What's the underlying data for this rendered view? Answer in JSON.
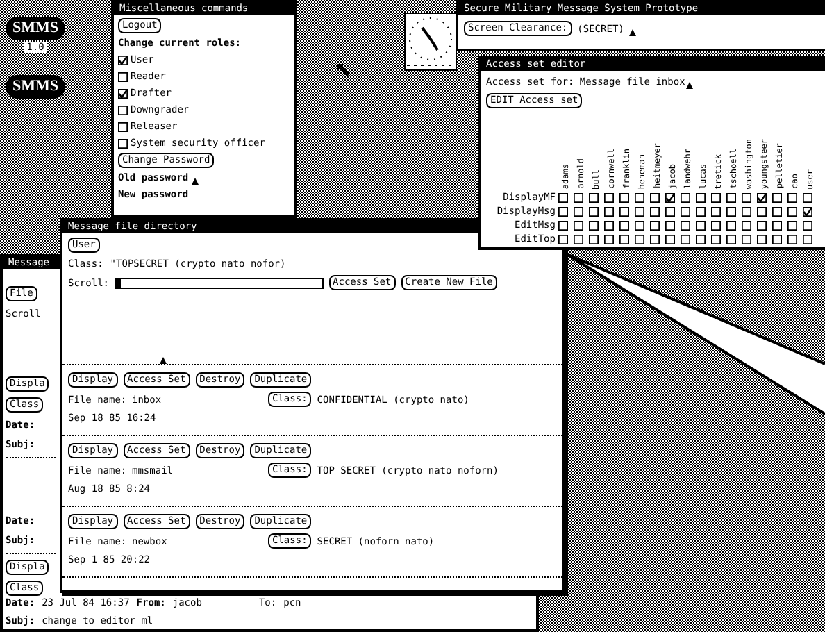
{
  "desktop_icons": [
    {
      "label": "SMMS",
      "caption": "1.0"
    },
    {
      "label": "SMMS"
    }
  ],
  "misc_window": {
    "title": "Miscellaneous commands",
    "logout": "Logout",
    "roles_heading": "Change current roles:",
    "roles": [
      {
        "label": "User",
        "checked": true
      },
      {
        "label": "Reader",
        "checked": false
      },
      {
        "label": "Drafter",
        "checked": true
      },
      {
        "label": "Downgrader",
        "checked": false
      },
      {
        "label": "Releaser",
        "checked": false
      },
      {
        "label": "System security officer",
        "checked": false
      }
    ],
    "change_password": "Change Password",
    "old_password": "Old password",
    "new_password": "New password"
  },
  "prototype_window": {
    "title": "Secure Military Message System Prototype",
    "clearance_button": "Screen Clearance:",
    "clearance": "(SECRET)"
  },
  "access_editor": {
    "title": "Access set editor",
    "access_for": "Access set for: Message file inbox",
    "edit_button": "EDIT Access set",
    "users": [
      "adams",
      "arnold",
      "bull",
      "cornwell",
      "franklin",
      "heneman",
      "heitmeyer",
      "jacob",
      "landwehr",
      "lucas",
      "tretick",
      "tschoell",
      "washington",
      "youngsteer",
      "pelletier",
      "cao",
      "user"
    ],
    "rows": [
      {
        "label": "DisplayMF",
        "checked": [
          false,
          false,
          false,
          false,
          false,
          false,
          false,
          true,
          false,
          false,
          false,
          false,
          false,
          true,
          false,
          false,
          false
        ]
      },
      {
        "label": "DisplayMsg",
        "checked": [
          false,
          false,
          false,
          false,
          false,
          false,
          false,
          false,
          false,
          false,
          false,
          false,
          false,
          false,
          false,
          false,
          true
        ]
      },
      {
        "label": "EditMsg",
        "checked": [
          false,
          false,
          false,
          false,
          false,
          false,
          false,
          false,
          false,
          false,
          false,
          false,
          false,
          false,
          false,
          false,
          false
        ]
      },
      {
        "label": "EditTop",
        "checked": [
          false,
          false,
          false,
          false,
          false,
          false,
          false,
          false,
          false,
          false,
          false,
          false,
          false,
          false,
          false,
          false,
          false
        ]
      }
    ]
  },
  "message_window": {
    "title": "Message",
    "side_items": [
      {
        "kind": "button",
        "text": "File"
      },
      {
        "kind": "text",
        "text": "Scroll"
      },
      {
        "kind": "gap"
      },
      {
        "kind": "button",
        "text": "Displa"
      },
      {
        "kind": "button",
        "text": "Class"
      },
      {
        "kind": "label",
        "text": "Date:"
      },
      {
        "kind": "label",
        "text": "Subj:"
      },
      {
        "kind": "rule"
      },
      {
        "kind": "gap"
      },
      {
        "kind": "label",
        "text": "Date:"
      },
      {
        "kind": "label",
        "text": "Subj:"
      },
      {
        "kind": "rule"
      },
      {
        "kind": "button",
        "text": "Displa"
      },
      {
        "kind": "button",
        "text": "Class"
      }
    ],
    "date_label": "Date:",
    "date": "23 Jul 84 16:37",
    "from_label": "From:",
    "from": "jacob",
    "to_label": "To:",
    "to": "pcn",
    "subj_label": "Subj:",
    "subj": "change to editor ml"
  },
  "directory_window": {
    "title": "Message file directory",
    "user_button": "User",
    "class_label": "Class:",
    "class_value": "\"TOPSECRET (crypto nato nofor)",
    "scroll_label": "Scroll:",
    "access_set_button": "Access Set",
    "create_button": "Create New File",
    "files": [
      {
        "buttons": [
          "Display",
          "Access Set",
          "Destroy",
          "Duplicate"
        ],
        "name_label": "File name:",
        "name": "inbox",
        "class_button": "Class:",
        "class": "CONFIDENTIAL (crypto nato)",
        "date": "Sep 18 85 16:24"
      },
      {
        "buttons": [
          "Display",
          "Access Set",
          "Destroy",
          "Duplicate"
        ],
        "name_label": "File name:",
        "name": "mmsmail",
        "class_button": "Class:",
        "class": "TOP SECRET (crypto nato noforn)",
        "date": "Aug 18 85 8:24"
      },
      {
        "buttons": [
          "Display",
          "Access Set",
          "Destroy",
          "Duplicate"
        ],
        "name_label": "File name:",
        "name": "newbox",
        "class_button": "Class:",
        "class": "SECRET (noforn nato)",
        "date": "Sep 1 85 20:22"
      }
    ]
  }
}
